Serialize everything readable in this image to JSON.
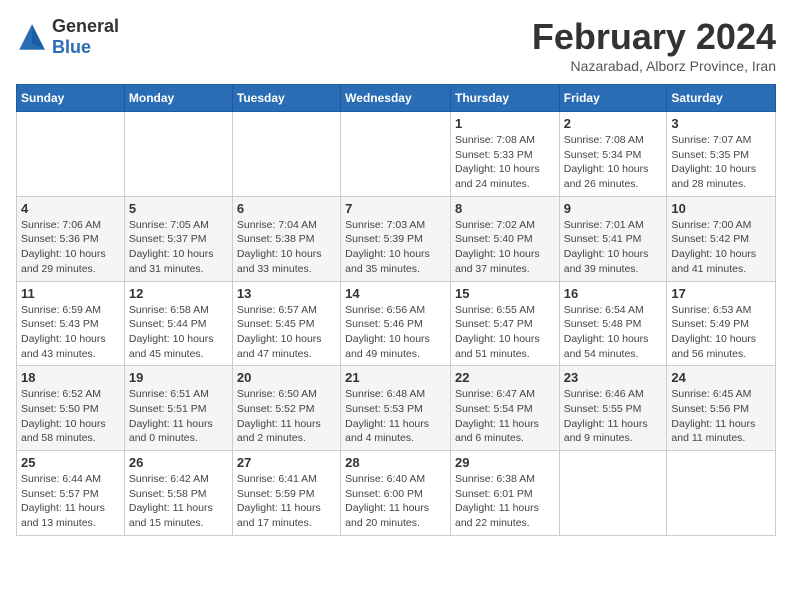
{
  "header": {
    "logo_general": "General",
    "logo_blue": "Blue",
    "month_title": "February 2024",
    "subtitle": "Nazarabad, Alborz Province, Iran"
  },
  "weekdays": [
    "Sunday",
    "Monday",
    "Tuesday",
    "Wednesday",
    "Thursday",
    "Friday",
    "Saturday"
  ],
  "weeks": [
    [
      {
        "day": "",
        "info": ""
      },
      {
        "day": "",
        "info": ""
      },
      {
        "day": "",
        "info": ""
      },
      {
        "day": "",
        "info": ""
      },
      {
        "day": "1",
        "info": "Sunrise: 7:08 AM\nSunset: 5:33 PM\nDaylight: 10 hours\nand 24 minutes."
      },
      {
        "day": "2",
        "info": "Sunrise: 7:08 AM\nSunset: 5:34 PM\nDaylight: 10 hours\nand 26 minutes."
      },
      {
        "day": "3",
        "info": "Sunrise: 7:07 AM\nSunset: 5:35 PM\nDaylight: 10 hours\nand 28 minutes."
      }
    ],
    [
      {
        "day": "4",
        "info": "Sunrise: 7:06 AM\nSunset: 5:36 PM\nDaylight: 10 hours\nand 29 minutes."
      },
      {
        "day": "5",
        "info": "Sunrise: 7:05 AM\nSunset: 5:37 PM\nDaylight: 10 hours\nand 31 minutes."
      },
      {
        "day": "6",
        "info": "Sunrise: 7:04 AM\nSunset: 5:38 PM\nDaylight: 10 hours\nand 33 minutes."
      },
      {
        "day": "7",
        "info": "Sunrise: 7:03 AM\nSunset: 5:39 PM\nDaylight: 10 hours\nand 35 minutes."
      },
      {
        "day": "8",
        "info": "Sunrise: 7:02 AM\nSunset: 5:40 PM\nDaylight: 10 hours\nand 37 minutes."
      },
      {
        "day": "9",
        "info": "Sunrise: 7:01 AM\nSunset: 5:41 PM\nDaylight: 10 hours\nand 39 minutes."
      },
      {
        "day": "10",
        "info": "Sunrise: 7:00 AM\nSunset: 5:42 PM\nDaylight: 10 hours\nand 41 minutes."
      }
    ],
    [
      {
        "day": "11",
        "info": "Sunrise: 6:59 AM\nSunset: 5:43 PM\nDaylight: 10 hours\nand 43 minutes."
      },
      {
        "day": "12",
        "info": "Sunrise: 6:58 AM\nSunset: 5:44 PM\nDaylight: 10 hours\nand 45 minutes."
      },
      {
        "day": "13",
        "info": "Sunrise: 6:57 AM\nSunset: 5:45 PM\nDaylight: 10 hours\nand 47 minutes."
      },
      {
        "day": "14",
        "info": "Sunrise: 6:56 AM\nSunset: 5:46 PM\nDaylight: 10 hours\nand 49 minutes."
      },
      {
        "day": "15",
        "info": "Sunrise: 6:55 AM\nSunset: 5:47 PM\nDaylight: 10 hours\nand 51 minutes."
      },
      {
        "day": "16",
        "info": "Sunrise: 6:54 AM\nSunset: 5:48 PM\nDaylight: 10 hours\nand 54 minutes."
      },
      {
        "day": "17",
        "info": "Sunrise: 6:53 AM\nSunset: 5:49 PM\nDaylight: 10 hours\nand 56 minutes."
      }
    ],
    [
      {
        "day": "18",
        "info": "Sunrise: 6:52 AM\nSunset: 5:50 PM\nDaylight: 10 hours\nand 58 minutes."
      },
      {
        "day": "19",
        "info": "Sunrise: 6:51 AM\nSunset: 5:51 PM\nDaylight: 11 hours\nand 0 minutes."
      },
      {
        "day": "20",
        "info": "Sunrise: 6:50 AM\nSunset: 5:52 PM\nDaylight: 11 hours\nand 2 minutes."
      },
      {
        "day": "21",
        "info": "Sunrise: 6:48 AM\nSunset: 5:53 PM\nDaylight: 11 hours\nand 4 minutes."
      },
      {
        "day": "22",
        "info": "Sunrise: 6:47 AM\nSunset: 5:54 PM\nDaylight: 11 hours\nand 6 minutes."
      },
      {
        "day": "23",
        "info": "Sunrise: 6:46 AM\nSunset: 5:55 PM\nDaylight: 11 hours\nand 9 minutes."
      },
      {
        "day": "24",
        "info": "Sunrise: 6:45 AM\nSunset: 5:56 PM\nDaylight: 11 hours\nand 11 minutes."
      }
    ],
    [
      {
        "day": "25",
        "info": "Sunrise: 6:44 AM\nSunset: 5:57 PM\nDaylight: 11 hours\nand 13 minutes."
      },
      {
        "day": "26",
        "info": "Sunrise: 6:42 AM\nSunset: 5:58 PM\nDaylight: 11 hours\nand 15 minutes."
      },
      {
        "day": "27",
        "info": "Sunrise: 6:41 AM\nSunset: 5:59 PM\nDaylight: 11 hours\nand 17 minutes."
      },
      {
        "day": "28",
        "info": "Sunrise: 6:40 AM\nSunset: 6:00 PM\nDaylight: 11 hours\nand 20 minutes."
      },
      {
        "day": "29",
        "info": "Sunrise: 6:38 AM\nSunset: 6:01 PM\nDaylight: 11 hours\nand 22 minutes."
      },
      {
        "day": "",
        "info": ""
      },
      {
        "day": "",
        "info": ""
      }
    ]
  ]
}
